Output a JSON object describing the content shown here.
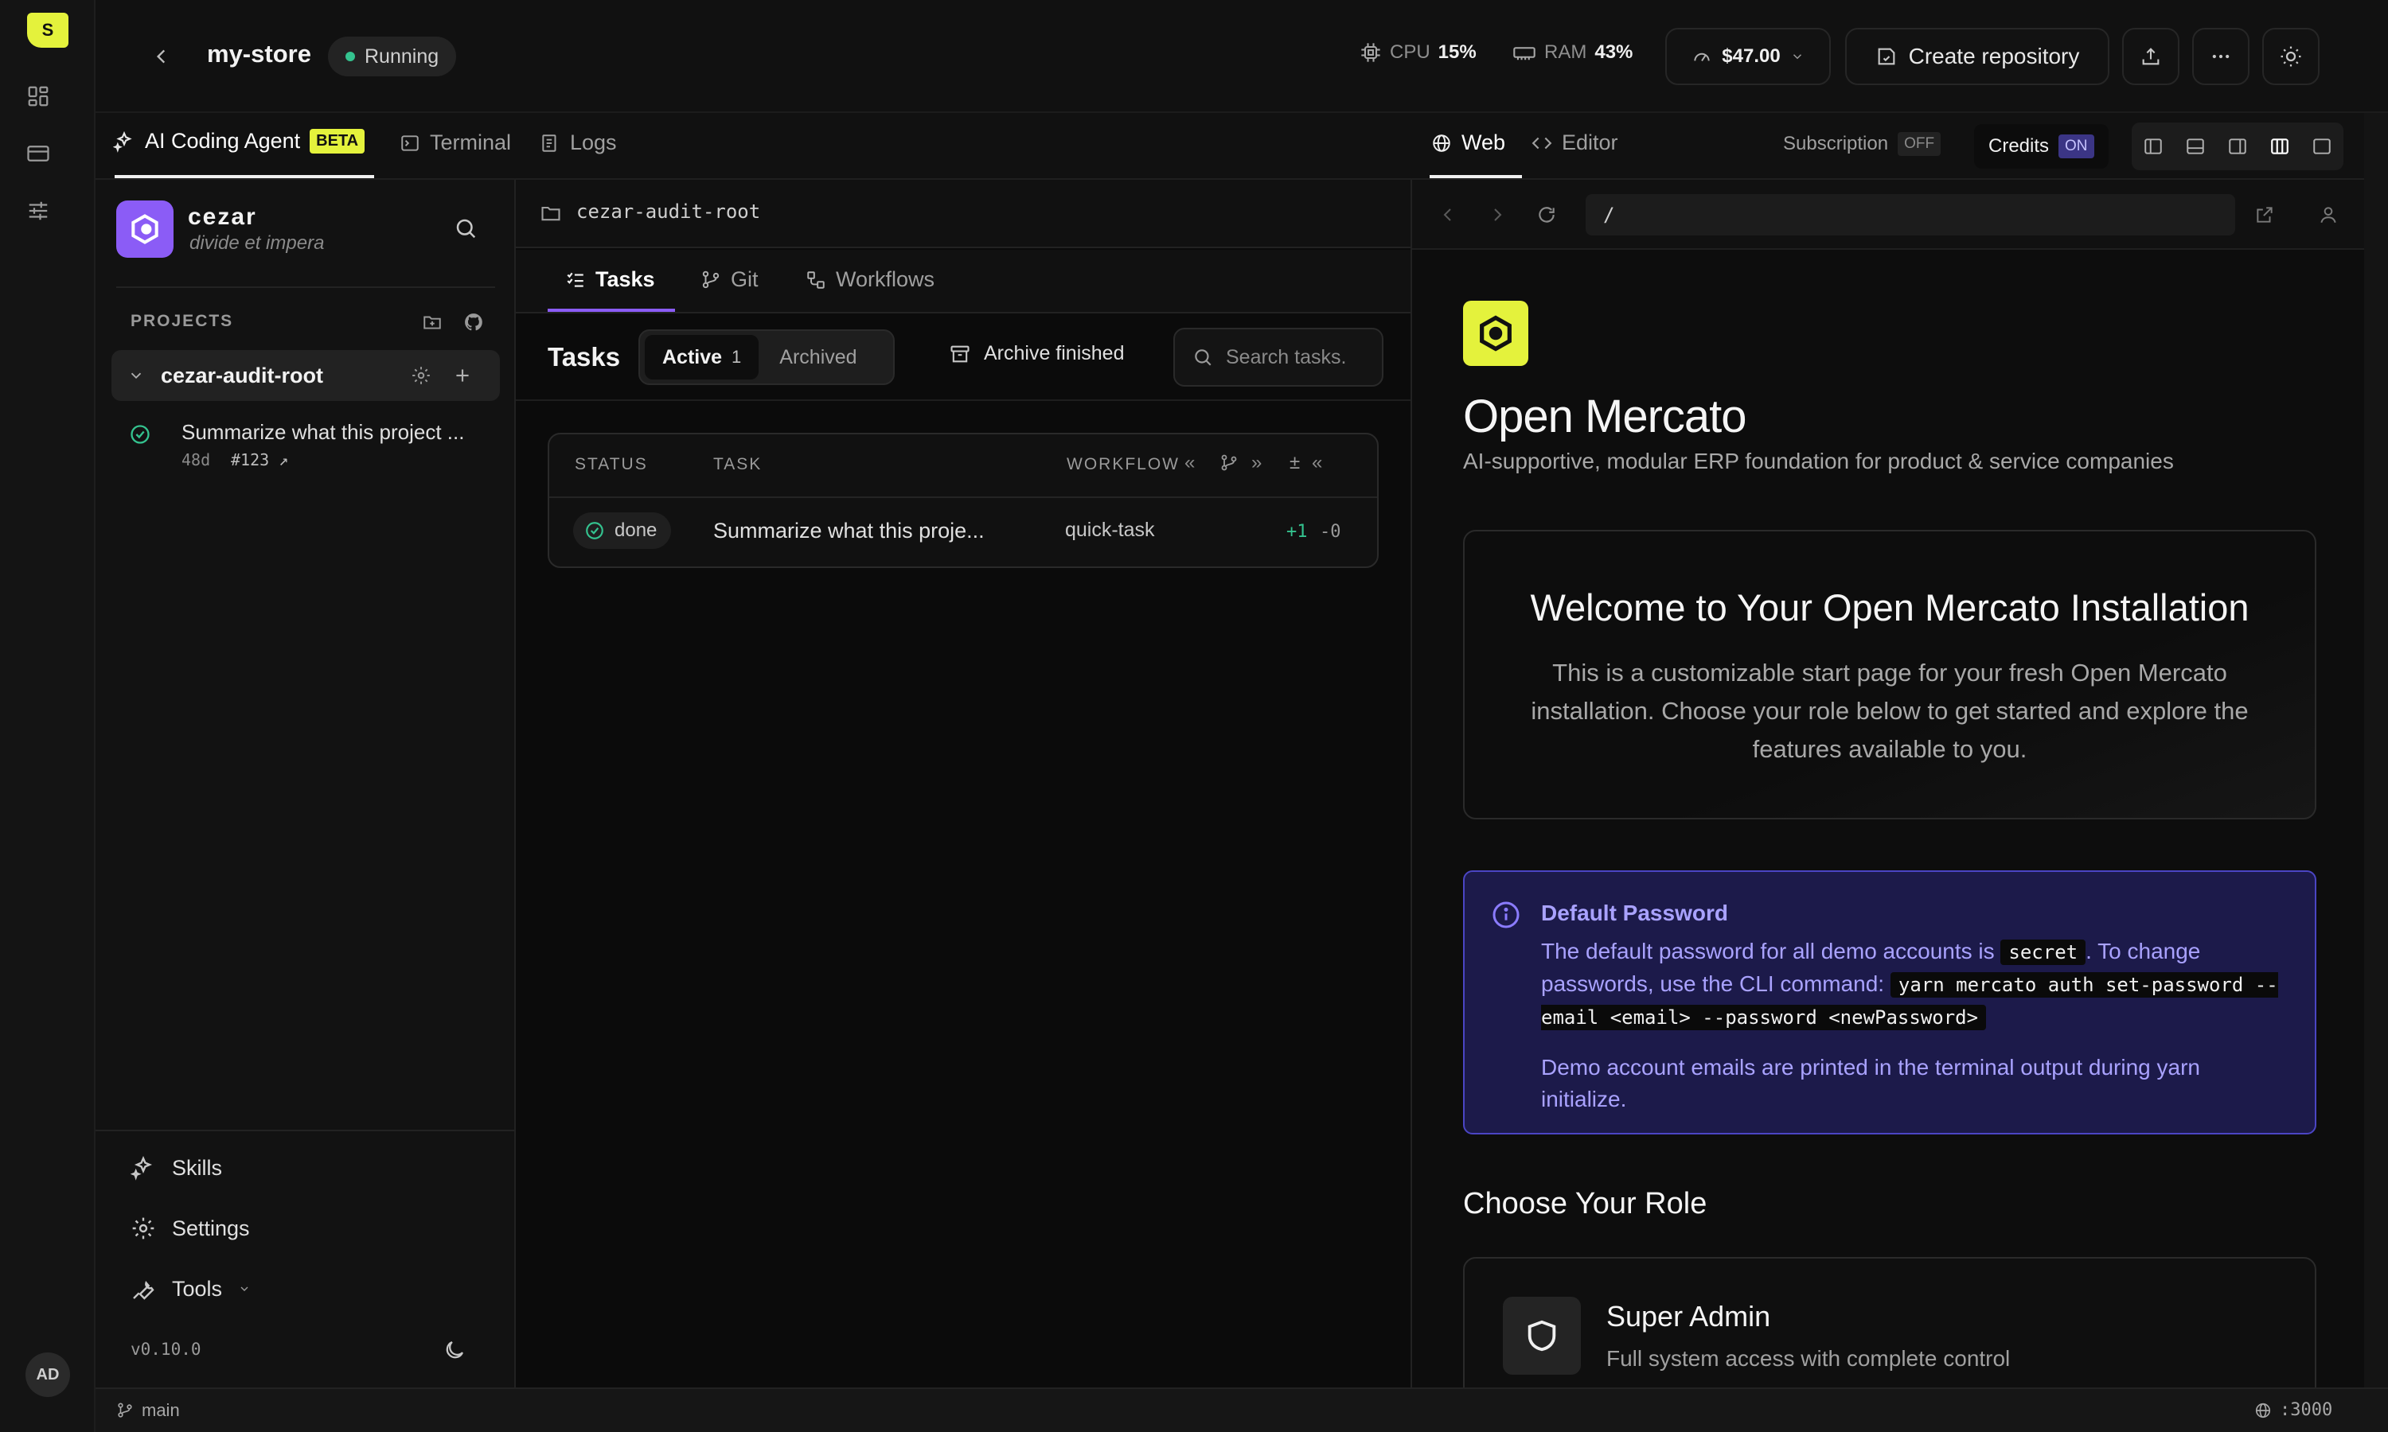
{
  "rail": {
    "logo_letter": "S",
    "avatar": "AD"
  },
  "header": {
    "title": "my-store",
    "status": "Running",
    "cpu_label": "CPU",
    "cpu_value": "15%",
    "ram_label": "RAM",
    "ram_value": "43%",
    "cost": "$47.00",
    "create_repo": "Create repository"
  },
  "agent_tabs": {
    "agent": "AI Coding Agent",
    "beta": "BETA",
    "terminal": "Terminal",
    "logs": "Logs"
  },
  "org": {
    "name": "cezar",
    "tagline": "divide et impera"
  },
  "projects": {
    "heading": "PROJECTS",
    "items": [
      {
        "name": "cezar-audit-root",
        "task_title": "Summarize what this project ...",
        "task_age": "48d",
        "task_ref": "#123 ↗"
      }
    ]
  },
  "sidebar_footer": {
    "skills": "Skills",
    "settings": "Settings",
    "tools": "Tools",
    "version": "v0.10.0"
  },
  "tasks_panel": {
    "path": "cezar-audit-root",
    "tabs": [
      "Tasks",
      "Git",
      "Workflows"
    ],
    "heading": "Tasks",
    "filter_active": "Active",
    "filter_active_count": "1",
    "filter_archived": "Archived",
    "archive_finished": "Archive finished",
    "search_placeholder": "Search tasks.",
    "columns": {
      "status": "STATUS",
      "task": "TASK",
      "workflow": "WORKFLOW",
      "diff": "±"
    },
    "rows": [
      {
        "status": "done",
        "task": "Summarize what this proje...",
        "workflow": "quick-task",
        "added": "+1",
        "removed": "-0"
      }
    ]
  },
  "preview_tabs": {
    "web": "Web",
    "editor": "Editor",
    "subscription": "Subscription",
    "subscription_state": "OFF",
    "credits": "Credits",
    "credits_state": "ON"
  },
  "url": "/",
  "site": {
    "title": "Open Mercato",
    "subtitle": "AI‑supportive, modular ERP foundation for product & service companies",
    "welcome_title": "Welcome to Your Open Mercato Installation",
    "welcome_text": "This is a customizable start page for your fresh Open Mercato installation. Choose your role below to get started and explore the features available to you.",
    "pw_title": "Default Password",
    "pw_text_1": "The default password for all demo accounts is",
    "pw_code": "secret",
    "pw_text_2": ". To change passwords, use the CLI command:",
    "pw_cmd": "yarn mercato auth set-password --email <email> --password <newPassword>",
    "pw_note": "Demo account emails are printed in the terminal output during yarn initialize.",
    "role_heading": "Choose Your Role",
    "role_title": "Super Admin",
    "role_desc": "Full system access with complete control"
  },
  "statusbar": {
    "branch": "main",
    "port": ":3000"
  },
  "colors": {
    "accent": "#e4f23c",
    "brand_purple": "#8b5cf6",
    "success": "#34c38f",
    "info_bg": "#1c1a4a",
    "info_border": "#4b45c4"
  }
}
